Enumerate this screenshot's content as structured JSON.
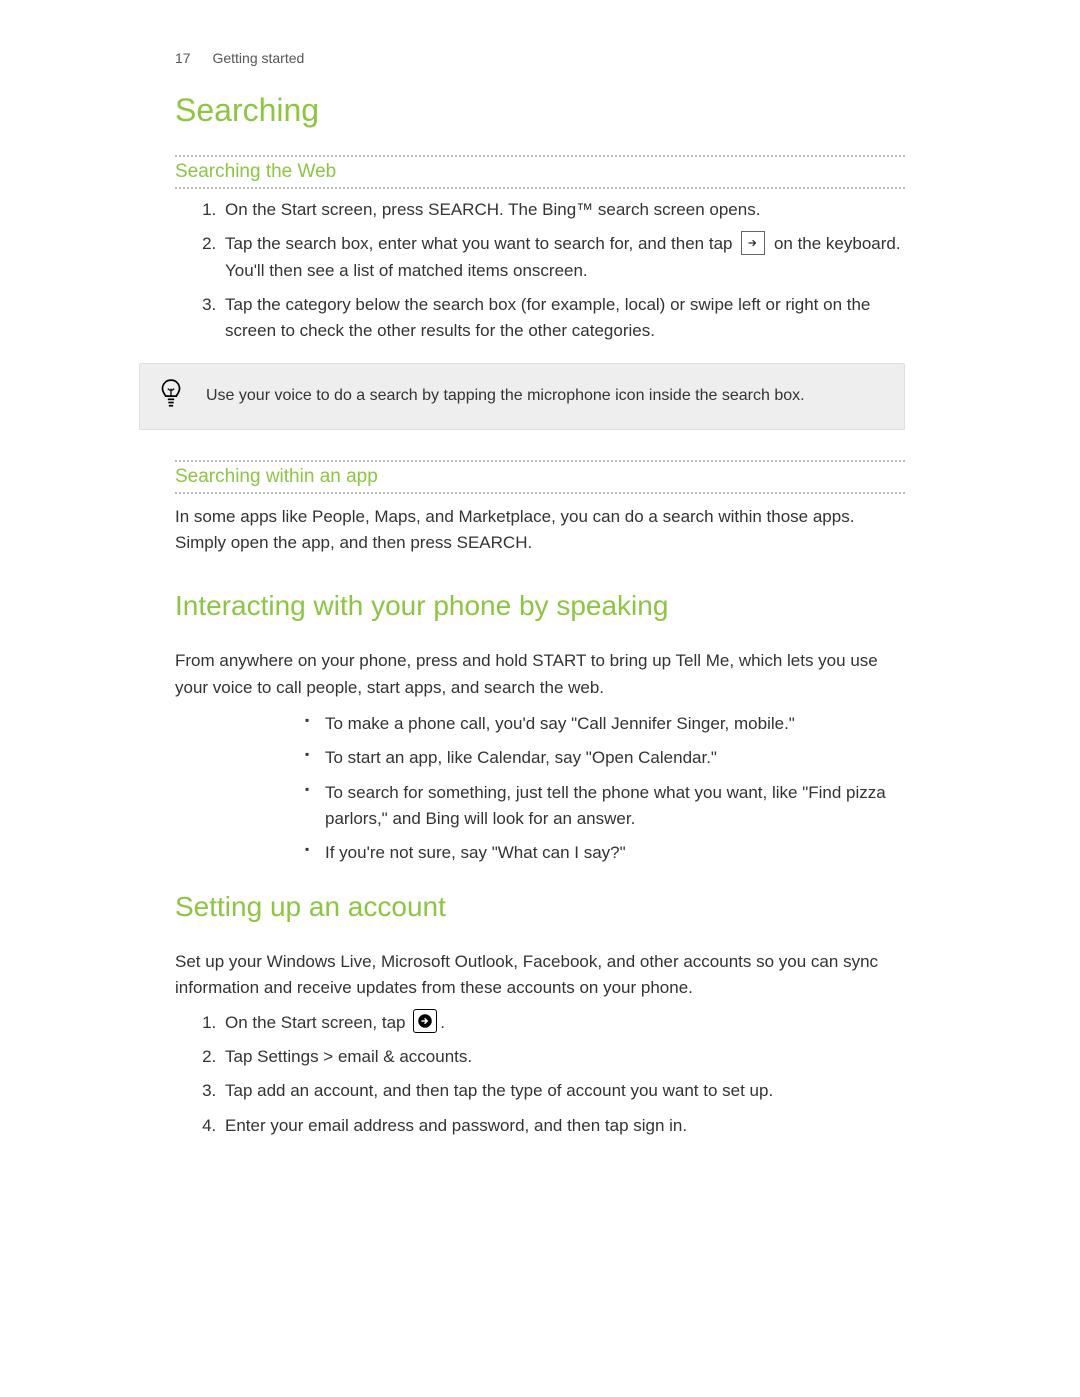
{
  "header": {
    "page_number": "17",
    "chapter": "Getting started"
  },
  "s1": {
    "title": "Searching",
    "sub1": {
      "title": "Searching the Web",
      "steps": {
        "i1": "On the Start screen, press SEARCH. The Bing™ search screen opens.",
        "i2a": "Tap the search box, enter what you want to search for, and then tap ",
        "i2b": " on the keyboard. You'll then see a list of matched items onscreen.",
        "i3": "Tap the category below the search box (for example, local) or swipe left or right on the screen to check the other results for the other categories."
      },
      "tip": "Use your voice to do a search by tapping the microphone icon inside the search box."
    },
    "sub2": {
      "title": "Searching within an app",
      "body": "In some apps like People, Maps, and Marketplace, you can do a search within those apps. Simply open the app, and then press SEARCH."
    }
  },
  "s2": {
    "title": "Interacting with your phone by speaking",
    "body": "From anywhere on your phone, press and hold START to bring up Tell Me, which lets you use your voice to call people, start apps, and search the web.",
    "bullets": {
      "b1": "To make a phone call, you'd say \"Call Jennifer Singer, mobile.\"",
      "b2": "To start an app, like Calendar, say \"Open Calendar.\"",
      "b3": "To search for something, just tell the phone what you want, like \"Find pizza parlors,\" and Bing will look for an answer.",
      "b4": "If you're not sure, say \"What can I say?\""
    }
  },
  "s3": {
    "title": "Setting up an account",
    "body": "Set up your Windows Live, Microsoft Outlook, Facebook, and other accounts so you can sync information and receive updates from these accounts on your phone.",
    "steps": {
      "i1a": "On the Start screen, tap ",
      "i1b": ".",
      "i2a": "Tap ",
      "i2b": "Settings > email & accounts",
      "i2c": ".",
      "i3a": "Tap ",
      "i3b": "add an account",
      "i3c": ", and then tap the type of account you want to set up.",
      "i4a": "Enter your email address and password, and then tap ",
      "i4b": "sign in",
      "i4c": "."
    }
  }
}
